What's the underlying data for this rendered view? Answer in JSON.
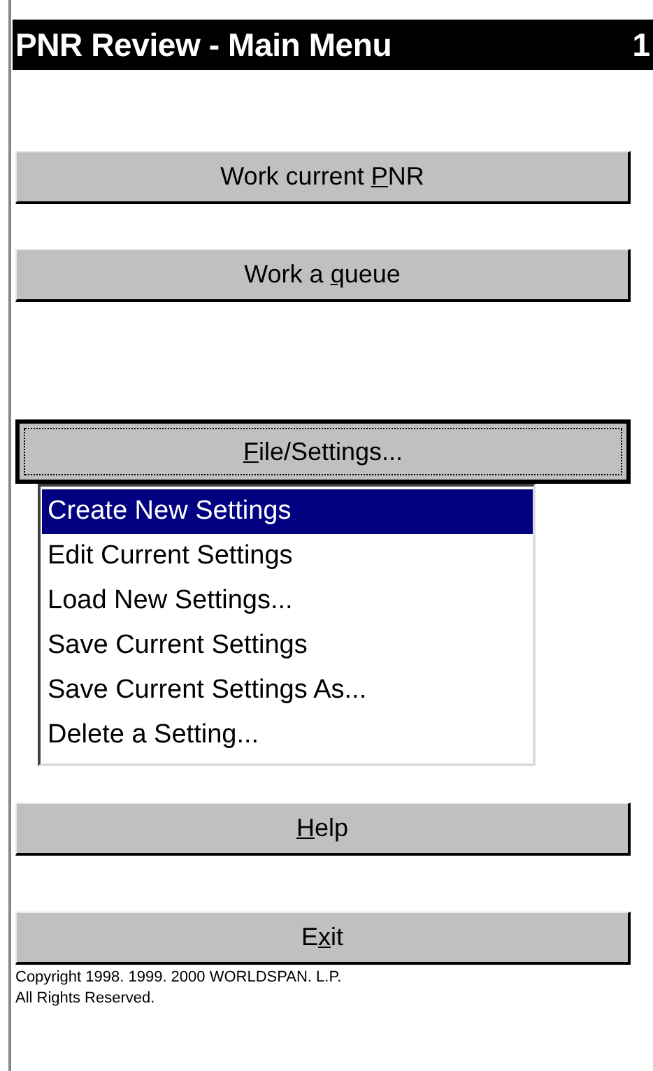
{
  "window": {
    "title": "PNR Review - Main Menu",
    "page_number": "1"
  },
  "buttons": [
    {
      "label_parts": [
        {
          "text": "Work current ",
          "underlined": false
        },
        {
          "text": "P",
          "underlined": true
        },
        {
          "text": "NR",
          "underlined": false
        }
      ],
      "focused": false
    },
    {
      "label_parts": [
        {
          "text": "Work a ",
          "underlined": false
        },
        {
          "text": "q",
          "underlined": true
        },
        {
          "text": "ueue",
          "underlined": false
        }
      ],
      "focused": false
    },
    {
      "label_parts": [
        {
          "text": "F",
          "underlined": true
        },
        {
          "text": "ile/Settings...",
          "underlined": false
        }
      ],
      "focused": true,
      "menu": [
        {
          "label": "Create New Settings",
          "selected": true
        },
        {
          "label": "Edit Current Settings",
          "selected": false
        },
        {
          "label": "Load New Settings...",
          "selected": false
        },
        {
          "label": "Save Current Settings",
          "selected": false
        },
        {
          "label": "Save Current Settings As...",
          "selected": false
        },
        {
          "label": "Delete a Setting...",
          "selected": false
        }
      ]
    },
    {
      "label_parts": [
        {
          "text": "H",
          "underlined": true
        },
        {
          "text": "elp",
          "underlined": false
        }
      ],
      "focused": false
    },
    {
      "label_parts": [
        {
          "text": "E",
          "underlined": false
        },
        {
          "text": "x",
          "underlined": true
        },
        {
          "text": "it",
          "underlined": false
        }
      ],
      "focused": false
    }
  ],
  "footer": [
    "Copyright 1998. 1999. 2000 WORLDSPAN. L.P.",
    "All Rights Reserved."
  ]
}
